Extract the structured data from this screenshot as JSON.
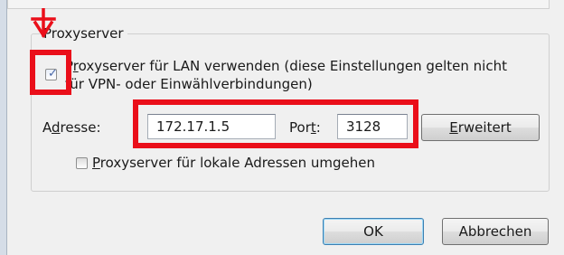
{
  "proxy": {
    "group_label": "Proxyserver",
    "use_proxy": {
      "checked": true,
      "line1_prefix": "P",
      "line1_mnemonic": "r",
      "line1_rest": "oxyserver für LAN verwenden (diese Einstellungen gelten nicht",
      "line2": "für VPN- oder Einwählverbindungen)"
    },
    "address": {
      "label_prefix": "A",
      "label_mnemonic": "d",
      "label_rest": "resse:",
      "value": "172.17.1.5"
    },
    "port": {
      "label_prefix": "Por",
      "label_mnemonic": "t",
      "label_rest": ":",
      "value": "3128"
    },
    "advanced_button": {
      "mnemonic": "E",
      "label_rest": "rweitert"
    },
    "bypass_local": {
      "checked": false,
      "mnemonic": "P",
      "label_rest": "roxyserver für lokale Adressen umgehen"
    }
  },
  "footer": {
    "ok_label": "OK",
    "cancel_label": "Abbrechen"
  },
  "colors": {
    "annotation_red": "#ea0f1a",
    "dialog_background": "#f0f0f0"
  },
  "icons": {
    "annotation": "down-arrow-icon"
  }
}
